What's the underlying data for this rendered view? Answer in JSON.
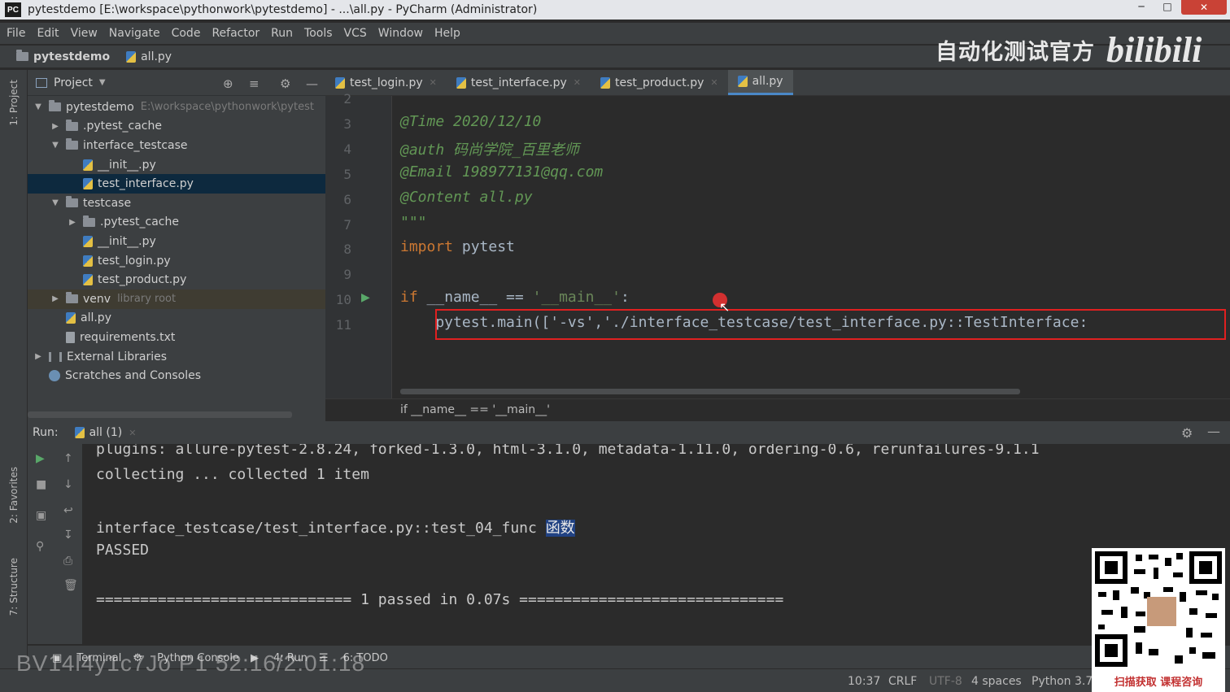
{
  "window": {
    "title": "pytestdemo [E:\\workspace\\pythonwork\\pytestdemo] - ...\\all.py - PyCharm (Administrator)",
    "app_icon": "PC"
  },
  "menu": [
    "File",
    "Edit",
    "View",
    "Navigate",
    "Code",
    "Refactor",
    "Run",
    "Tools",
    "VCS",
    "Window",
    "Help"
  ],
  "nav": {
    "project": "pytestdemo",
    "file": "all.py"
  },
  "brand": {
    "cn": "自动化测试官方",
    "logo": "bilibili"
  },
  "left_tools": {
    "project": "1: Project",
    "favorites": "2: Favorites",
    "structure": "7: Structure"
  },
  "project_panel": {
    "title": "Project",
    "tree": [
      {
        "label": "pytestdemo",
        "hint": "E:\\workspace\\pythonwork\\pytest",
        "depth": 0,
        "type": "folder",
        "expanded": true
      },
      {
        "label": ".pytest_cache",
        "depth": 1,
        "type": "folder",
        "expanded": false
      },
      {
        "label": "interface_testcase",
        "depth": 1,
        "type": "folder",
        "expanded": true
      },
      {
        "label": "__init__.py",
        "depth": 2,
        "type": "py"
      },
      {
        "label": "test_interface.py",
        "depth": 2,
        "type": "py",
        "selected": true
      },
      {
        "label": "testcase",
        "depth": 1,
        "type": "folder",
        "expanded": true
      },
      {
        "label": ".pytest_cache",
        "depth": 2,
        "type": "folder",
        "expanded": false
      },
      {
        "label": "__init__.py",
        "depth": 2,
        "type": "py"
      },
      {
        "label": "test_login.py",
        "depth": 2,
        "type": "py"
      },
      {
        "label": "test_product.py",
        "depth": 2,
        "type": "py"
      },
      {
        "label": "venv",
        "hint": "library root",
        "depth": 1,
        "type": "folder",
        "expanded": false,
        "venv": true
      },
      {
        "label": "all.py",
        "depth": 1,
        "type": "py"
      },
      {
        "label": "requirements.txt",
        "depth": 1,
        "type": "txt"
      },
      {
        "label": "External Libraries",
        "depth": 0,
        "type": "lib",
        "expanded": false
      },
      {
        "label": "Scratches and Consoles",
        "depth": 0,
        "type": "scratch"
      }
    ]
  },
  "editor_tabs": [
    {
      "label": "test_login.py",
      "active": false
    },
    {
      "label": "test_interface.py",
      "active": false
    },
    {
      "label": "test_product.py",
      "active": false
    },
    {
      "label": "all.py",
      "active": true
    }
  ],
  "code_lines": [
    {
      "num": "2",
      "text": ""
    },
    {
      "num": "3",
      "text": "@Time 2020/12/10",
      "style": "cmt"
    },
    {
      "num": "4",
      "text": "@auth 码尚学院_百里老师",
      "style": "cmt"
    },
    {
      "num": "5",
      "text": "@Email 198977131@qq.com",
      "style": "cmt"
    },
    {
      "num": "6",
      "text": "@Content all.py",
      "style": "cmt"
    },
    {
      "num": "7",
      "text": "\"\"\"",
      "style": "cmt"
    },
    {
      "num": "8",
      "kw": "import",
      "rest": " pytest"
    },
    {
      "num": "9",
      "text": ""
    },
    {
      "num": "10",
      "kw": "if",
      "rest": " __name__ == ",
      "str": "'__main__'",
      "tail": ":"
    },
    {
      "num": "11",
      "text": "    pytest.main(['-vs','./interface_testcase/test_interface.py::TestInterface:"
    }
  ],
  "code_breadcrumb": "if __name__ == '__main__'",
  "run": {
    "label": "Run:",
    "tab": "all (1)"
  },
  "console": [
    "plugins: allure-pytest-2.8.24, forked-1.3.0, html-3.1.0, metadata-1.11.0, ordering-0.6, rerunfailures-9.1.1",
    "collecting ... collected 1 item",
    "",
    "interface_testcase/test_interface.py::test_04_func ",
    "PASSED",
    "",
    "============================= 1 passed in 0.07s =============================="
  ],
  "console_highlight": "函数",
  "bottom_tabs": [
    "Terminal",
    "Python Console",
    "4: Run",
    "6: TODO"
  ],
  "status": {
    "position": "10:37",
    "line_sep": "CRLF",
    "encoding": "UTF-8",
    "indent": "4 spaces",
    "interpreter": "Python 3.7"
  },
  "watermark": "BV14l4y1c7Jo P1 52:16/2:01:18",
  "qr_caption": "扫描获取 课程咨询"
}
